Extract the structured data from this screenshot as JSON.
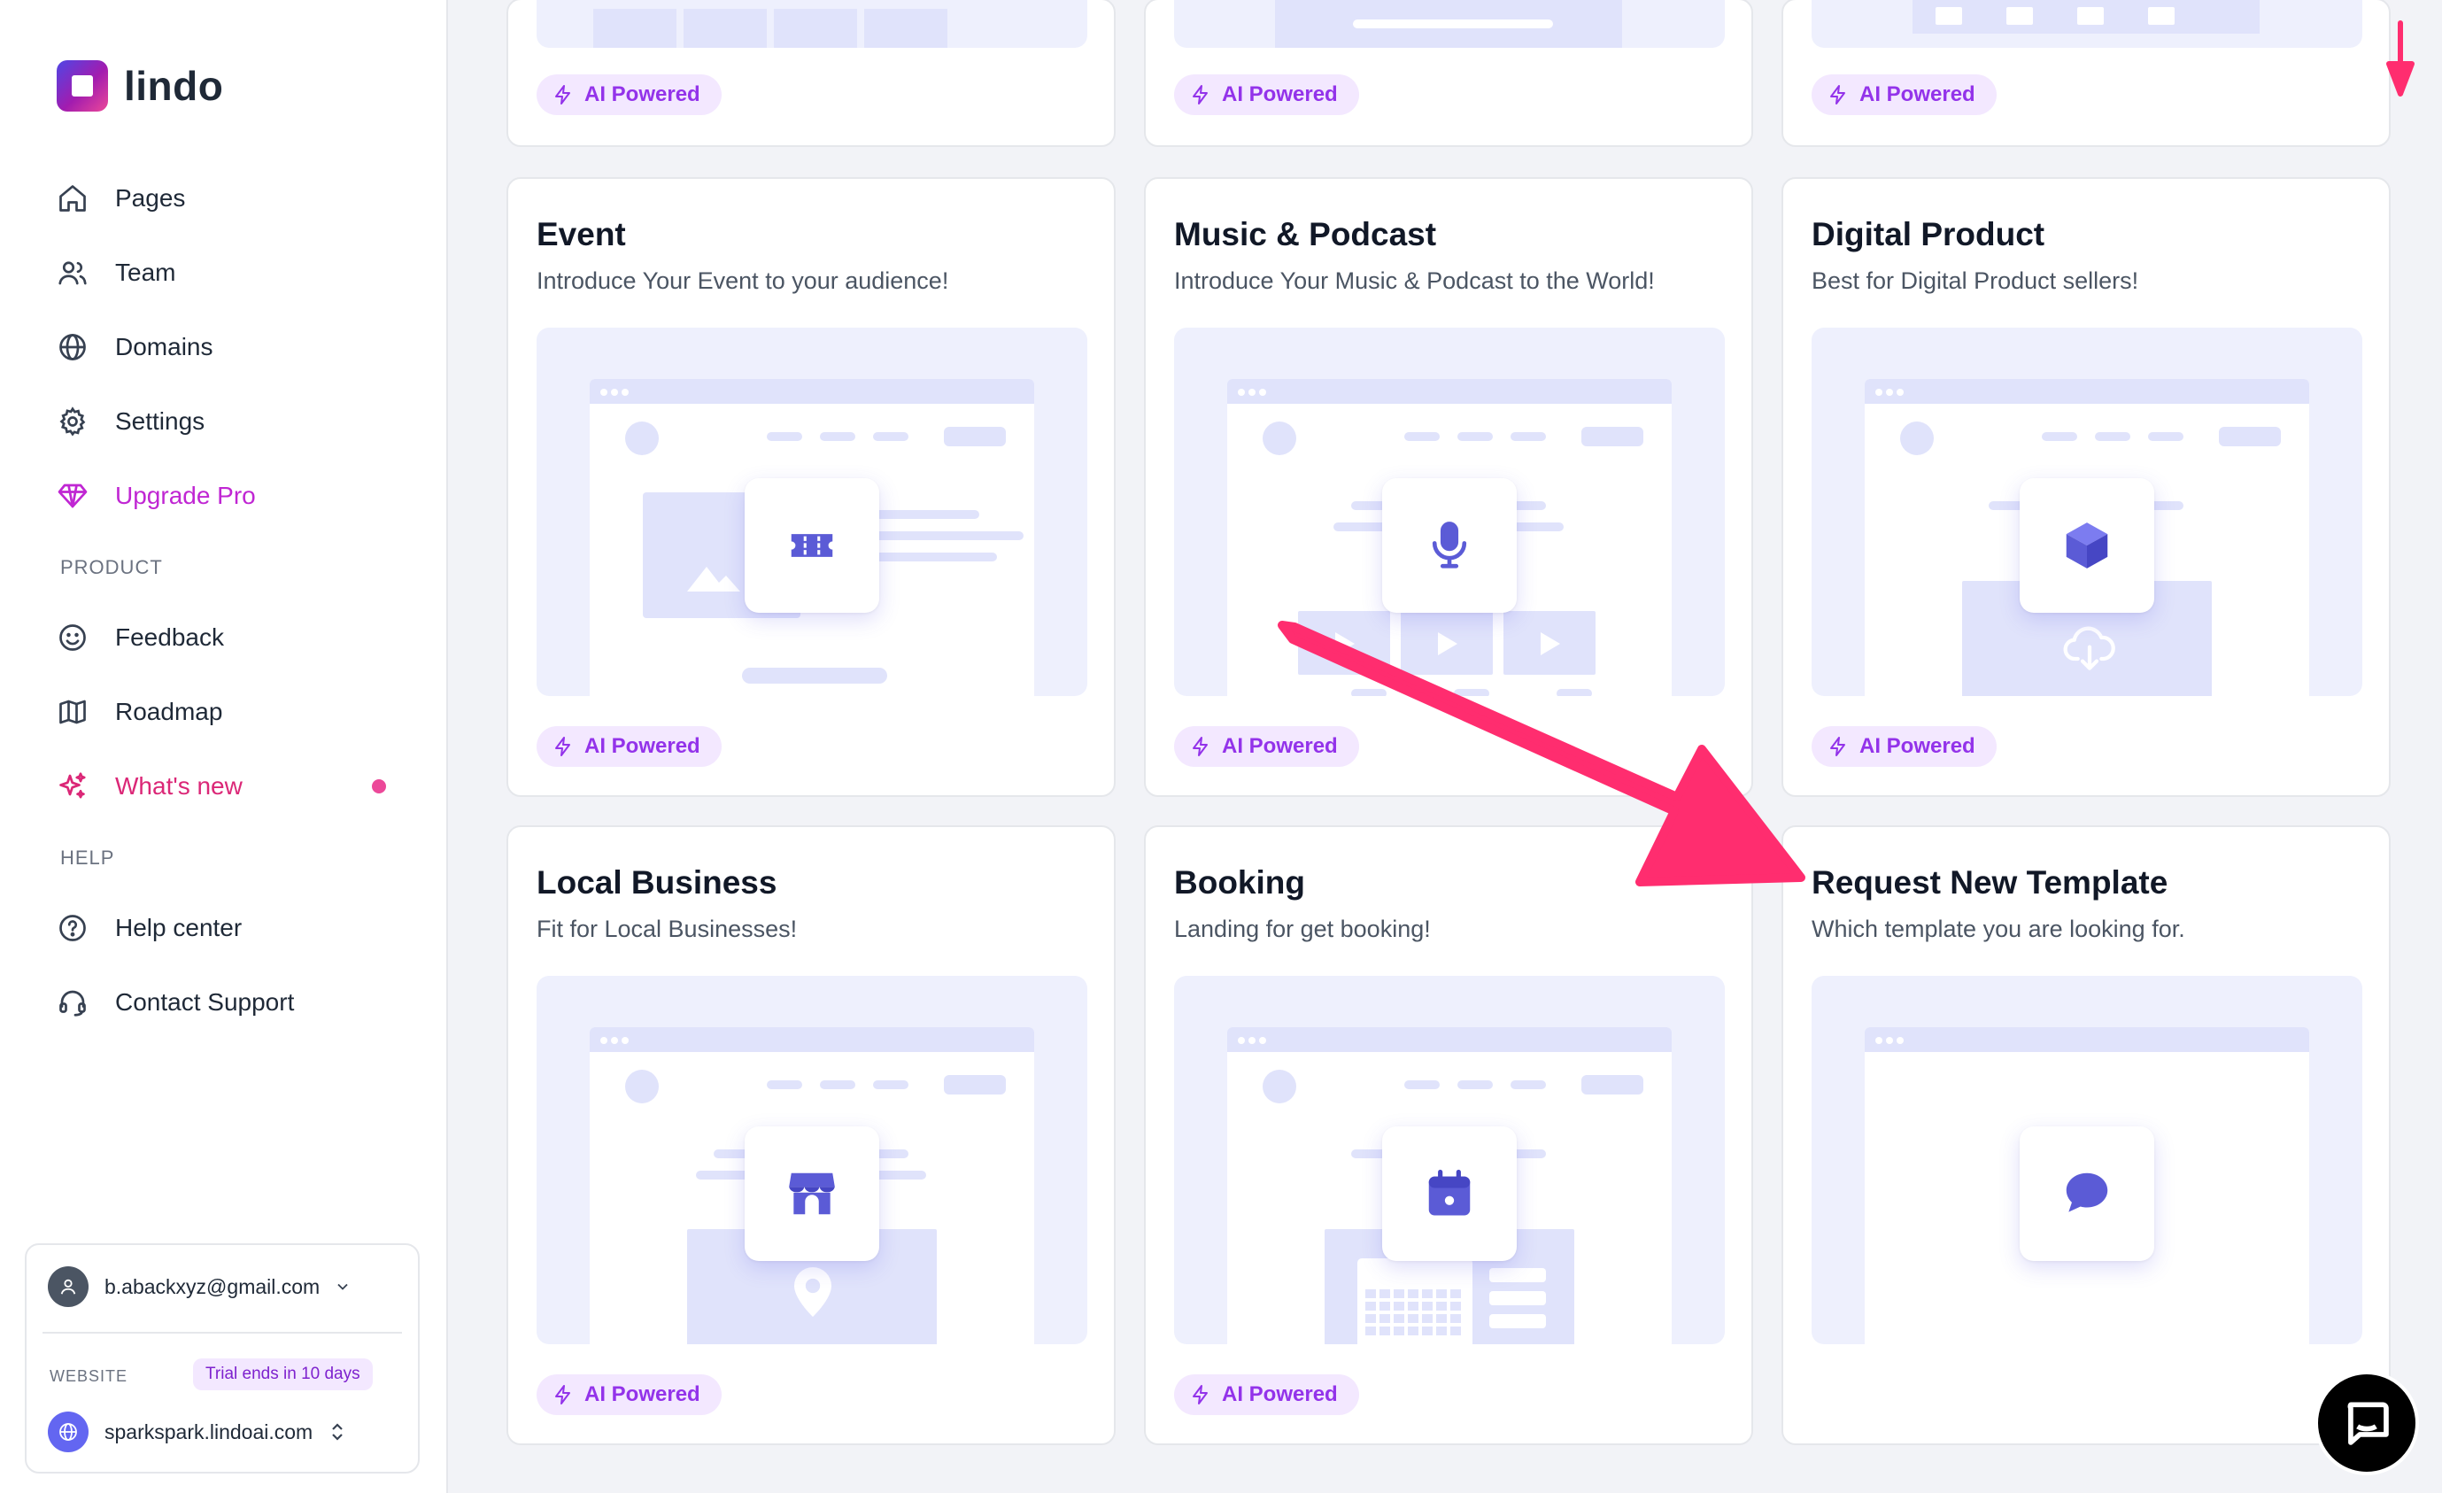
{
  "app": {
    "name": "lindo"
  },
  "sidebar": {
    "nav": [
      {
        "label": "Pages",
        "icon": "home-icon"
      },
      {
        "label": "Team",
        "icon": "users-icon"
      },
      {
        "label": "Domains",
        "icon": "globe-icon"
      },
      {
        "label": "Settings",
        "icon": "gear-icon"
      },
      {
        "label": "Upgrade Pro",
        "icon": "diamond-icon"
      }
    ],
    "product_label": "PRODUCT",
    "product": [
      {
        "label": "Feedback",
        "icon": "smile-icon"
      },
      {
        "label": "Roadmap",
        "icon": "map-icon"
      },
      {
        "label": "What's new",
        "icon": "sparkles-icon"
      }
    ],
    "help_label": "HELP",
    "help": [
      {
        "label": "Help center",
        "icon": "question-circle-icon"
      },
      {
        "label": "Contact Support",
        "icon": "headset-icon"
      }
    ],
    "account": {
      "email": "b.abackxyz@gmail.com",
      "website_label": "WEBSITE",
      "trial": "Trial ends in 10 days",
      "site": "sparkspark.lindoai.com"
    }
  },
  "badge_label": "AI Powered",
  "cards": [
    {
      "title": "Event",
      "subtitle": "Introduce Your Event to your audience!",
      "icon": "ticket-icon"
    },
    {
      "title": "Music & Podcast",
      "subtitle": "Introduce Your Music & Podcast to the World!",
      "icon": "microphone-icon"
    },
    {
      "title": "Digital Product",
      "subtitle": "Best for Digital Product sellers!",
      "icon": "cube-icon"
    },
    {
      "title": "Local Business",
      "subtitle": "Fit for Local Businesses!",
      "icon": "store-icon"
    },
    {
      "title": "Booking",
      "subtitle": "Landing for get booking!",
      "icon": "calendar-icon"
    },
    {
      "title": "Request New Template",
      "subtitle": "Which template you are looking for.",
      "icon": "chat-bubble-icon"
    }
  ],
  "colors": {
    "accent": "#6366f1",
    "brand_pink": "#db2777",
    "annotation_arrow": "#ff2d6f",
    "badge_bg": "#f3e8ff",
    "badge_text": "#9333ea"
  }
}
